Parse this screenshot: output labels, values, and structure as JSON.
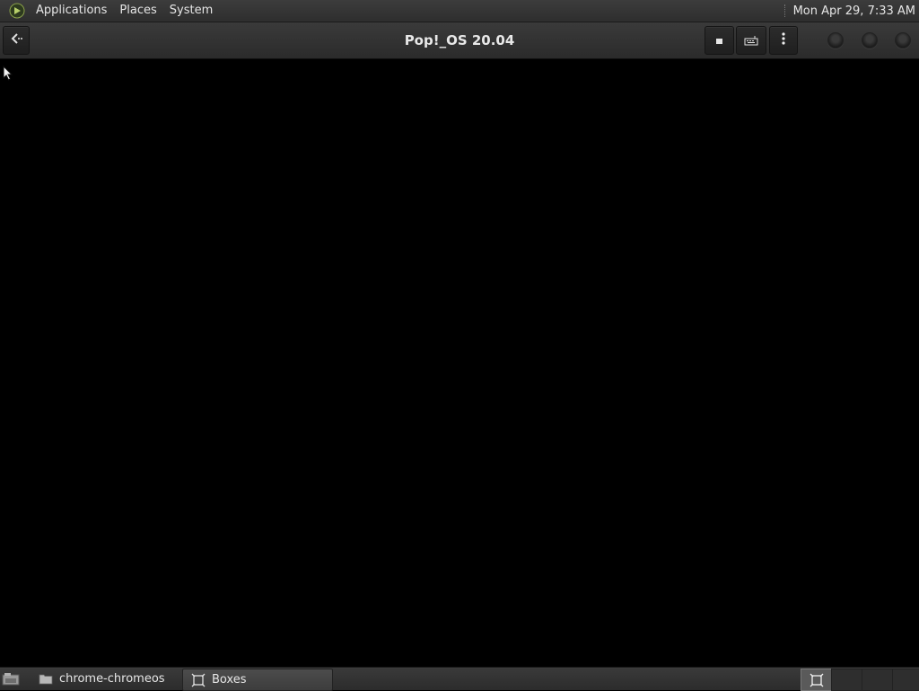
{
  "top_panel": {
    "menus": [
      "Applications",
      "Places",
      "System"
    ],
    "clock": "Mon Apr 29,  7:33 AM",
    "logo_icon": "gnome-foot-icon"
  },
  "headerbar": {
    "title": "Pop!_OS 20.04",
    "back_icon": "back-arrow-icon",
    "buttons": [
      "stop-icon",
      "keyboard-icon",
      "kebab-menu-icon"
    ]
  },
  "taskbar": {
    "tasks": [
      {
        "label": "chrome-chromeos",
        "icon": "folder-icon",
        "active": false
      },
      {
        "label": "Boxes",
        "icon": "boxes-icon",
        "active": true
      }
    ],
    "workspaces": 4,
    "active_workspace": 1
  },
  "colors": {
    "panel": "#333333",
    "display": "#000000",
    "text": "#e6e6e6"
  }
}
